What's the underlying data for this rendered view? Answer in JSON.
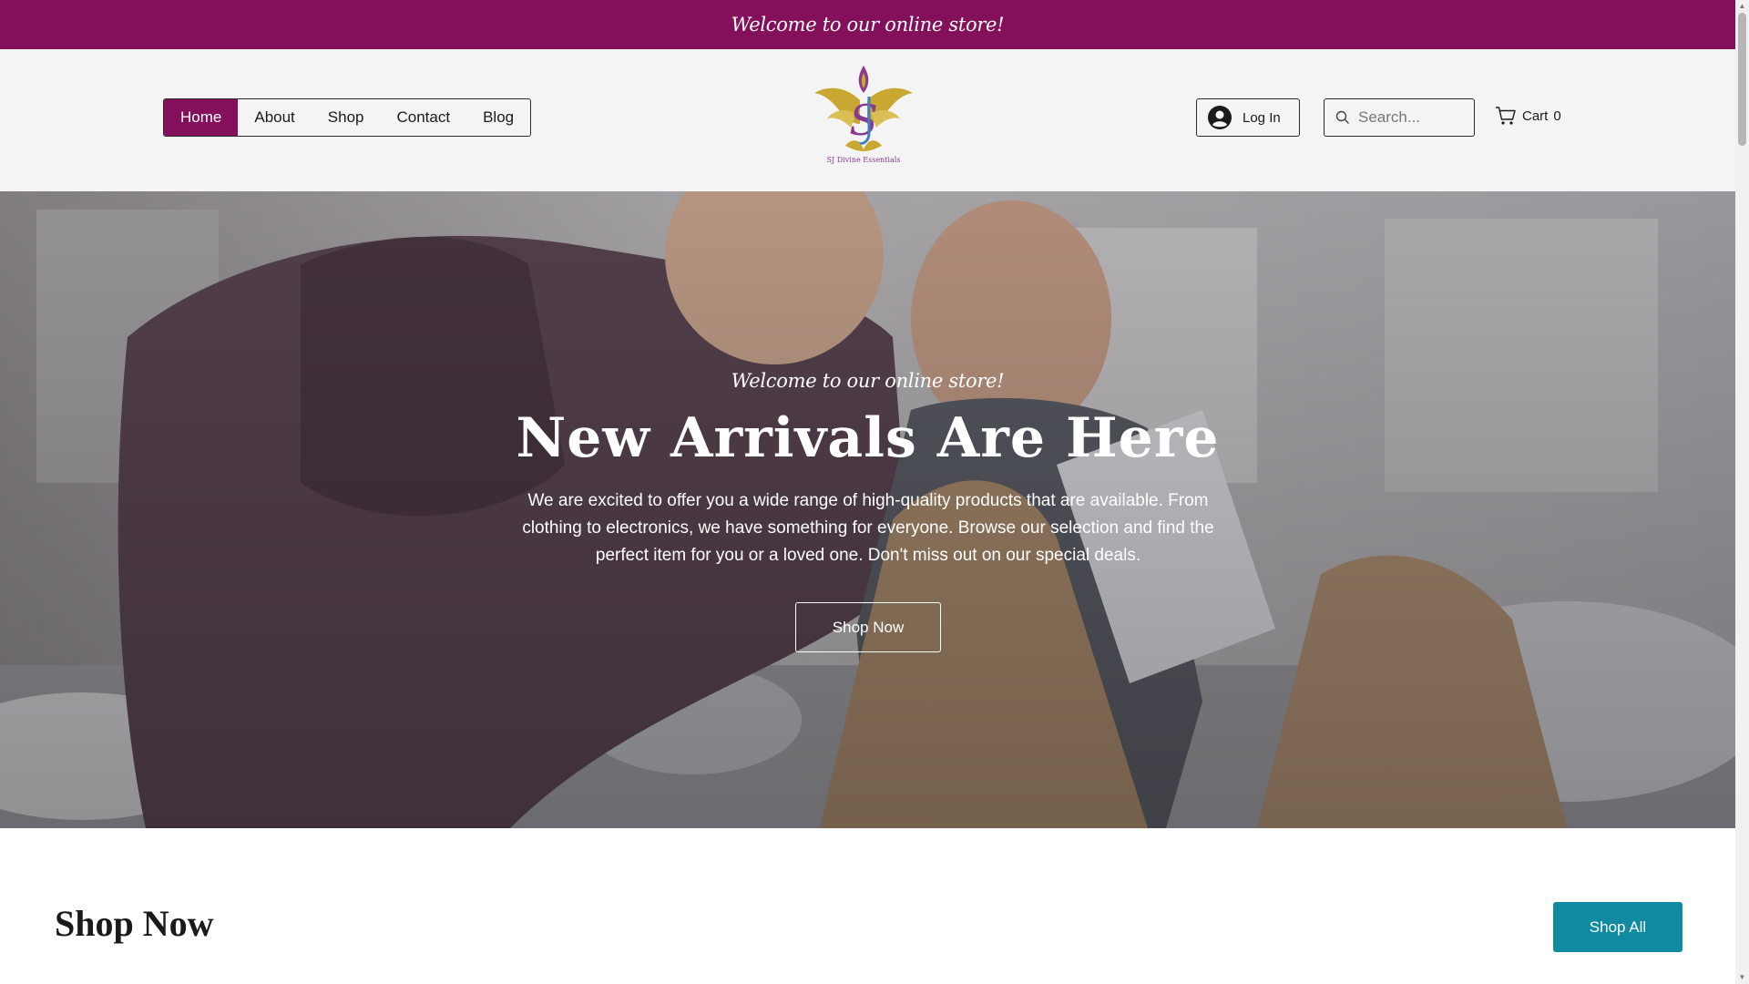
{
  "announcement": {
    "text": "Welcome to our online store!"
  },
  "nav": {
    "items": [
      {
        "label": "Home",
        "active": true
      },
      {
        "label": "About",
        "active": false
      },
      {
        "label": "Shop",
        "active": false
      },
      {
        "label": "Contact",
        "active": false
      },
      {
        "label": "Blog",
        "active": false
      }
    ]
  },
  "logo": {
    "brand_text": "SJ Divine Essentials",
    "monogram": "SJ"
  },
  "header": {
    "login_label": "Log In",
    "search_placeholder": "Search...",
    "cart_label": "Cart",
    "cart_count": "0"
  },
  "hero": {
    "tagline": "Welcome to our online store!",
    "title": "New Arrivals Are Here",
    "description": "We are excited to offer you a wide range of high-quality products that are available. From clothing to electronics, we have something for everyone. Browse our selection and find the perfect item for you or a loved one. Don't miss out on our special deals.",
    "cta_label": "Shop Now"
  },
  "shop_section": {
    "title": "Shop Now",
    "shop_all_label": "Shop All"
  },
  "colors": {
    "brand": "#84105b",
    "accent": "#0f8aa1",
    "header_bg": "#f4f4f4",
    "logo_gold": "#c8a830",
    "logo_purple": "#8b3a8f"
  },
  "icons": [
    "user-avatar-icon",
    "search-icon",
    "cart-icon",
    "lotus-logo-icon"
  ]
}
